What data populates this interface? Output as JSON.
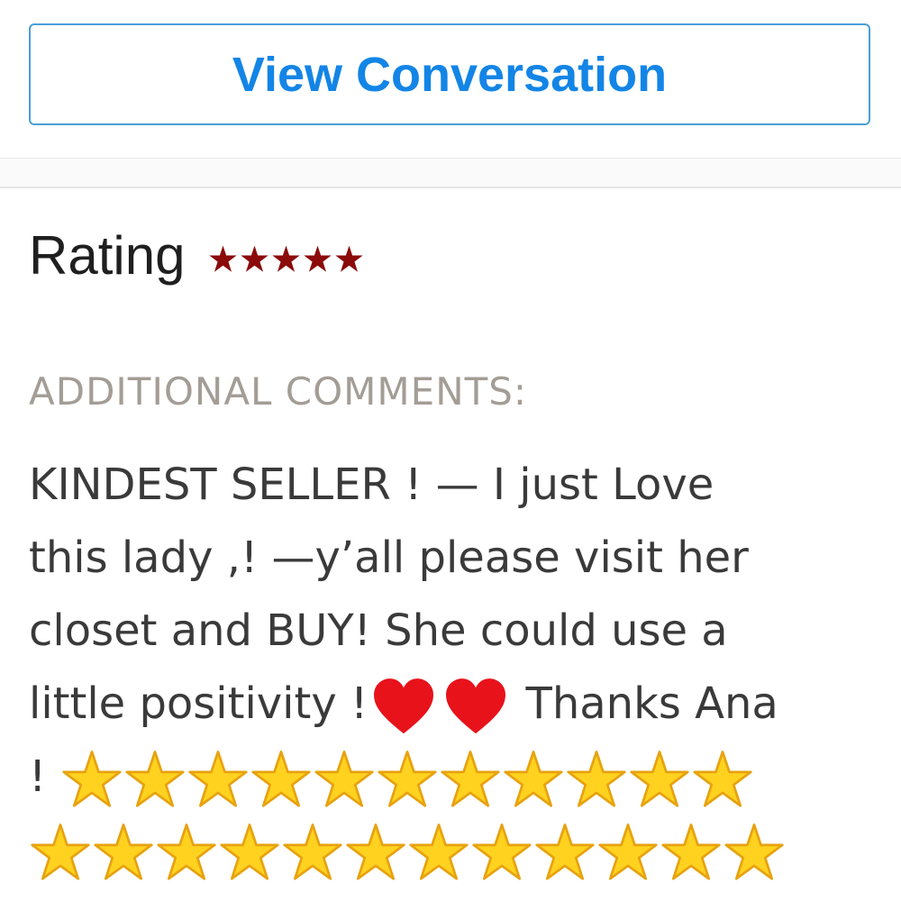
{
  "view_conversation": {
    "label": "View Conversation"
  },
  "rating": {
    "label": "Rating",
    "value": 5,
    "max": 5,
    "star_color": "#8b0a0a"
  },
  "comments": {
    "heading": "ADDITIONAL COMMENTS:",
    "line1": "KINDEST SELLER ! — I just Love",
    "line2": "this lady ,! —y’all please visit her",
    "line3": "closet and BUY! She could use a",
    "line4_text": "little positivity !",
    "line4_end": " Thanks Ana",
    "line5_prefix": "! ",
    "emoji_heart_count": 2,
    "emoji_star_row1_count": 11,
    "emoji_star_row2_count": 12,
    "emoji_names": {
      "heart": "red-heart-emoji",
      "star": "star-emoji"
    }
  },
  "colors": {
    "accent": "#1385e6",
    "heading": "#a39d96",
    "text": "#3a3a3a"
  }
}
